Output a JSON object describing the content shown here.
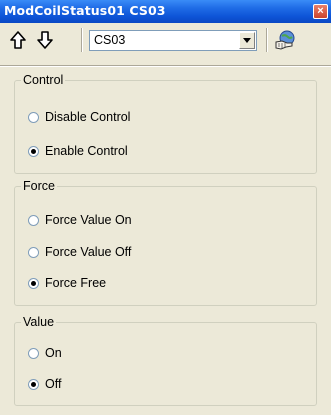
{
  "window": {
    "title": "ModCoilStatus01 CS03",
    "close_glyph": "×"
  },
  "toolbar": {
    "up_icon": "arrow-up-icon",
    "down_icon": "arrow-down-icon",
    "selected_point": "CS03",
    "action_icon": "globe-hand-icon"
  },
  "groups": {
    "control": {
      "label": "Control",
      "options": [
        {
          "label": "Disable Control",
          "selected": false
        },
        {
          "label": "Enable Control",
          "selected": true
        }
      ]
    },
    "force": {
      "label": "Force",
      "options": [
        {
          "label": "Force Value On",
          "selected": false
        },
        {
          "label": "Force Value Off",
          "selected": false
        },
        {
          "label": "Force Free",
          "selected": true
        }
      ]
    },
    "value": {
      "label": "Value",
      "options": [
        {
          "label": "On",
          "selected": false
        },
        {
          "label": "Off",
          "selected": true
        }
      ]
    }
  },
  "colors": {
    "title_bar": "#0E55D8",
    "background": "#ECE9D8",
    "close_button": "#C9442E"
  }
}
